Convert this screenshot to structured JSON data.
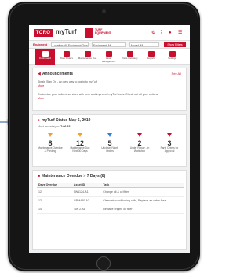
{
  "app": {
    "brand": "TORO",
    "title": "myTurf",
    "partner_logo": "TURF EQUIPMENT"
  },
  "topbar_icons": [
    "settings-icon",
    "help-icon",
    "user-icon",
    "menu-icon"
  ],
  "filter": {
    "label": "Equipment",
    "selects": [
      "Location: All Equipment Groups",
      "Equipment: All",
      "Model: All"
    ],
    "button": "Show Filters"
  },
  "nav": {
    "items": [
      {
        "label": "Dashboard",
        "icon": "dashboard-icon",
        "active": true
      },
      {
        "label": "Work Orders",
        "icon": "work-orders-icon",
        "active": false
      },
      {
        "label": "Maintenance Due",
        "icon": "maintenance-icon",
        "active": false
      },
      {
        "label": "Asset Management",
        "icon": "asset-icon",
        "active": false
      },
      {
        "label": "Parts Inventory",
        "icon": "parts-icon",
        "active": false
      },
      {
        "label": "Reports",
        "icon": "reports-icon",
        "active": false
      },
      {
        "label": "Settings",
        "icon": "settings-icon",
        "active": false
      }
    ]
  },
  "announcements": {
    "title": "Announcements",
    "see_all": "See All",
    "line1": "Single Sign On - An new way to log in to myTurf",
    "link1": "More",
    "line2": "Customize your suite of services with new and improved myTurf tools. Check out all your options",
    "link2": "More"
  },
  "status": {
    "title": "myTurf Status  May 6, 2019",
    "last_sync_label": "Most recent sync:",
    "last_sync_value": "7:06:33",
    "stats": [
      {
        "num": "8",
        "label": "Maintenance Overdue & Pending"
      },
      {
        "num": "12",
        "label": "Maintenance Due Next 30 Days"
      },
      {
        "num": "5",
        "label": "Unclosed Work Orders"
      },
      {
        "num": "2",
        "label": "Under Repair - In Workshop"
      },
      {
        "num": "3",
        "label": "Parts Orders for Approval"
      }
    ]
  },
  "maintenance": {
    "title": "Maintenance Overdue > 7 Days (8)",
    "columns": [
      "Days Overdue",
      "Asset ID",
      "Task"
    ],
    "rows": [
      [
        "12",
        "5W1124-A1",
        "Change oil & oil filter"
      ],
      [
        "12",
        "GRM450-A3",
        "Clean air conditioning coils, Replace air cabin fuse"
      ],
      [
        "14",
        "Turf 2-A1",
        "Replace engine oil filter"
      ]
    ]
  },
  "colors": {
    "brand_red": "#c8102e",
    "warning_orange": "#f0a030"
  }
}
